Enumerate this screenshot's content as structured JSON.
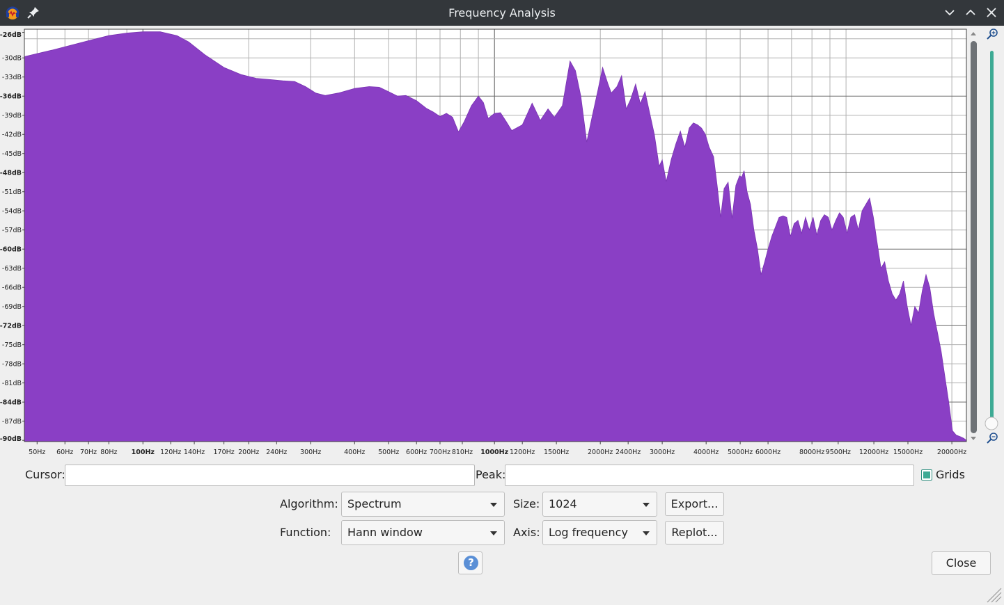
{
  "window": {
    "title": "Frequency Analysis",
    "icons": {
      "app": "audacity-logo-icon",
      "pin": "pin-icon",
      "minimize": "chevron-down-icon",
      "maximize": "chevron-up-icon",
      "close": "close-icon"
    }
  },
  "chart_data": {
    "type": "area",
    "xscale": "log",
    "xlim": [
      46,
      22000
    ],
    "ylim": [
      -90,
      -25
    ],
    "grid": true,
    "fill_color": "#8a3fc5",
    "y_ticks": [
      "-26dB",
      "-30dB",
      "-33dB",
      "-36dB",
      "-39dB",
      "-42dB",
      "-45dB",
      "-48dB",
      "-51dB",
      "-54dB",
      "-57dB",
      "-60dB",
      "-63dB",
      "-66dB",
      "-69dB",
      "-72dB",
      "-75dB",
      "-78dB",
      "-81dB",
      "-84dB",
      "-87dB",
      "-90dB"
    ],
    "y_tick_values": [
      -26,
      -30,
      -33,
      -36,
      -39,
      -42,
      -45,
      -48,
      -51,
      -54,
      -57,
      -60,
      -63,
      -66,
      -69,
      -72,
      -75,
      -78,
      -81,
      -84,
      -87,
      -90
    ],
    "y_bold": [
      -26,
      -36,
      -48,
      -60,
      -72,
      -84,
      -90
    ],
    "x_ticks": [
      "50Hz",
      "60Hz",
      "70Hz",
      "80Hz",
      "100Hz",
      "120Hz",
      "140Hz",
      "170Hz",
      "200Hz",
      "240Hz",
      "300Hz",
      "400Hz",
      "500Hz",
      "600Hz",
      "700Hz",
      "810Hz",
      "1000Hz",
      "1200Hz",
      "1500Hz",
      "2000Hz",
      "2400Hz",
      "3000Hz",
      "4000Hz",
      "5000Hz",
      "6000Hz",
      "8000Hz",
      "9500Hz",
      "12000Hz",
      "15000Hz",
      "20000Hz"
    ],
    "x_tick_values": [
      50,
      60,
      70,
      80,
      100,
      120,
      140,
      170,
      200,
      240,
      300,
      400,
      500,
      600,
      700,
      810,
      1000,
      1200,
      1500,
      2000,
      2400,
      3000,
      4000,
      5000,
      6000,
      8000,
      9500,
      12000,
      15000,
      20000
    ],
    "x_bold": [
      100,
      1000
    ],
    "spectrum": [
      [
        46,
        -29.8
      ],
      [
        55,
        -28.8
      ],
      [
        70,
        -27.3
      ],
      [
        80,
        -26.5
      ],
      [
        90,
        -26.1
      ],
      [
        100,
        -25.9
      ],
      [
        112,
        -25.9
      ],
      [
        125,
        -26.5
      ],
      [
        135,
        -27.5
      ],
      [
        150,
        -29.5
      ],
      [
        170,
        -31.5
      ],
      [
        190,
        -32.6
      ],
      [
        210,
        -33.2
      ],
      [
        230,
        -33.4
      ],
      [
        250,
        -33.6
      ],
      [
        270,
        -33.7
      ],
      [
        290,
        -34.5
      ],
      [
        310,
        -35.5
      ],
      [
        330,
        -35.9
      ],
      [
        360,
        -35.5
      ],
      [
        400,
        -34.8
      ],
      [
        440,
        -34.5
      ],
      [
        470,
        -34.6
      ],
      [
        500,
        -35.3
      ],
      [
        530,
        -36.0
      ],
      [
        560,
        -35.9
      ],
      [
        600,
        -36.7
      ],
      [
        640,
        -37.9
      ],
      [
        670,
        -38.5
      ],
      [
        700,
        -39.2
      ],
      [
        730,
        -38.7
      ],
      [
        760,
        -39.3
      ],
      [
        790,
        -41.6
      ],
      [
        820,
        -40.0
      ],
      [
        860,
        -37.5
      ],
      [
        900,
        -36.0
      ],
      [
        930,
        -37.0
      ],
      [
        960,
        -39.5
      ],
      [
        1000,
        -38.7
      ],
      [
        1040,
        -38.6
      ],
      [
        1080,
        -40.0
      ],
      [
        1120,
        -41.4
      ],
      [
        1200,
        -40.5
      ],
      [
        1280,
        -37.1
      ],
      [
        1350,
        -39.8
      ],
      [
        1420,
        -38.0
      ],
      [
        1480,
        -39.3
      ],
      [
        1560,
        -37.5
      ],
      [
        1640,
        -30.5
      ],
      [
        1700,
        -32.0
      ],
      [
        1760,
        -36.0
      ],
      [
        1830,
        -43.2
      ],
      [
        1900,
        -39.0
      ],
      [
        1970,
        -35.0
      ],
      [
        2030,
        -31.5
      ],
      [
        2100,
        -34.0
      ],
      [
        2150,
        -35.5
      ],
      [
        2230,
        -34.5
      ],
      [
        2300,
        -32.8
      ],
      [
        2370,
        -38.0
      ],
      [
        2440,
        -36.5
      ],
      [
        2520,
        -34.1
      ],
      [
        2600,
        -37.2
      ],
      [
        2680,
        -35.3
      ],
      [
        2760,
        -38.5
      ],
      [
        2850,
        -42.0
      ],
      [
        2940,
        -47.0
      ],
      [
        3000,
        -46.0
      ],
      [
        3080,
        -49.4
      ],
      [
        3180,
        -46.0
      ],
      [
        3280,
        -43.5
      ],
      [
        3380,
        -41.5
      ],
      [
        3480,
        -44.0
      ],
      [
        3580,
        -41.0
      ],
      [
        3680,
        -40.2
      ],
      [
        3780,
        -40.5
      ],
      [
        3880,
        -41.0
      ],
      [
        3980,
        -42.0
      ],
      [
        4080,
        -44.0
      ],
      [
        4200,
        -45.5
      ],
      [
        4300,
        -50.0
      ],
      [
        4400,
        -55.0
      ],
      [
        4500,
        -50.5
      ],
      [
        4620,
        -49.5
      ],
      [
        4740,
        -55.2
      ],
      [
        4860,
        -50.0
      ],
      [
        4980,
        -48.5
      ],
      [
        5050,
        -48.7
      ],
      [
        5130,
        -47.7
      ],
      [
        5230,
        -51.0
      ],
      [
        5350,
        -53.0
      ],
      [
        5470,
        -57.0
      ],
      [
        5600,
        -60.0
      ],
      [
        5730,
        -64.0
      ],
      [
        5870,
        -62.0
      ],
      [
        6000,
        -60.0
      ],
      [
        6150,
        -58.0
      ],
      [
        6300,
        -56.5
      ],
      [
        6450,
        -55.0
      ],
      [
        6620,
        -54.8
      ],
      [
        6780,
        -55.0
      ],
      [
        6950,
        -58.0
      ],
      [
        7120,
        -56.0
      ],
      [
        7300,
        -55.5
      ],
      [
        7480,
        -57.5
      ],
      [
        7670,
        -55.0
      ],
      [
        7860,
        -57.0
      ],
      [
        8060,
        -55.0
      ],
      [
        8260,
        -57.8
      ],
      [
        8470,
        -55.5
      ],
      [
        8680,
        -54.6
      ],
      [
        8900,
        -55.0
      ],
      [
        9120,
        -57.0
      ],
      [
        9350,
        -55.5
      ],
      [
        9580,
        -54.3
      ],
      [
        9820,
        -55.0
      ],
      [
        10070,
        -57.5
      ],
      [
        10320,
        -55.0
      ],
      [
        10580,
        -54.6
      ],
      [
        10840,
        -57.0
      ],
      [
        11110,
        -54.0
      ],
      [
        11390,
        -53.0
      ],
      [
        11670,
        -52.0
      ],
      [
        11960,
        -55.0
      ],
      [
        12260,
        -59.0
      ],
      [
        12570,
        -63.0
      ],
      [
        12880,
        -62.0
      ],
      [
        13200,
        -65.0
      ],
      [
        13530,
        -67.0
      ],
      [
        13870,
        -68.0
      ],
      [
        14210,
        -67.0
      ],
      [
        14570,
        -65.0
      ],
      [
        14930,
        -69.0
      ],
      [
        15310,
        -72.0
      ],
      [
        15690,
        -69.0
      ],
      [
        16080,
        -70.0
      ],
      [
        16480,
        -66.5
      ],
      [
        16890,
        -64.0
      ],
      [
        17310,
        -66.0
      ],
      [
        17750,
        -70.0
      ],
      [
        18190,
        -73.0
      ],
      [
        18640,
        -76.0
      ],
      [
        19110,
        -80.0
      ],
      [
        19590,
        -84.0
      ],
      [
        20080,
        -88.5
      ],
      [
        20580,
        -89.2
      ],
      [
        21100,
        -89.4
      ],
      [
        21630,
        -89.7
      ],
      [
        22000,
        -90.0
      ]
    ]
  },
  "controls": {
    "cursor_label": "Cursor:",
    "cursor_value": "",
    "peak_label": "Peak:",
    "peak_value": "",
    "grids_label": "Grids",
    "grids_checked": true,
    "algorithm_label": "Algorithm:",
    "algorithm_value": "Spectrum",
    "size_label": "Size:",
    "size_value": "1024",
    "function_label": "Function:",
    "function_value": "Hann window",
    "axis_label": "Axis:",
    "axis_value": "Log frequency",
    "export_label": "Export...",
    "replot_label": "Replot...",
    "help_label": "?",
    "close_label": "Close"
  },
  "colors": {
    "accent": "#3daa94",
    "titlebar": "#33373b",
    "help": "#5a8fd6"
  }
}
